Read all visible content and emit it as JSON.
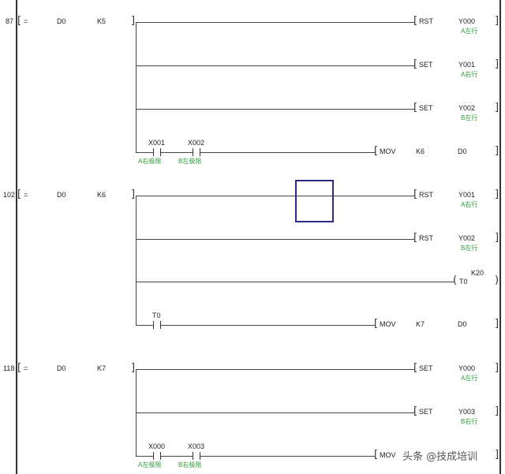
{
  "rungs": [
    {
      "step": "87",
      "compare": {
        "op": "=",
        "s1": "D0",
        "s2": "K5"
      },
      "outputs": [
        {
          "type": "instr",
          "instr": "RST",
          "operand": "Y000",
          "comment": "A左行"
        },
        {
          "type": "instr",
          "instr": "SET",
          "operand": "Y001",
          "comment": "A右行"
        },
        {
          "type": "instr",
          "instr": "SET",
          "operand": "Y002",
          "comment": "B左行"
        },
        {
          "type": "mov",
          "contacts": [
            {
              "name": "X001",
              "comment": "A右极限"
            },
            {
              "name": "X002",
              "comment": "B左极限"
            }
          ],
          "instr": "MOV",
          "src": "K6",
          "dst": "D0"
        }
      ]
    },
    {
      "step": "102",
      "compare": {
        "op": "=",
        "s1": "D0",
        "s2": "K6"
      },
      "outputs": [
        {
          "type": "instr",
          "instr": "RST",
          "operand": "Y001",
          "comment": "A右行"
        },
        {
          "type": "instr",
          "instr": "RST",
          "operand": "Y002",
          "comment": "B左行"
        },
        {
          "type": "timer",
          "coil": "T0",
          "preset": "K20"
        },
        {
          "type": "mov",
          "contacts": [
            {
              "name": "T0",
              "comment": ""
            }
          ],
          "instr": "MOV",
          "src": "K7",
          "dst": "D0"
        }
      ]
    },
    {
      "step": "118",
      "compare": {
        "op": "=",
        "s1": "D0",
        "s2": "K7"
      },
      "outputs": [
        {
          "type": "instr",
          "instr": "SET",
          "operand": "Y000",
          "comment": "A左行"
        },
        {
          "type": "instr",
          "instr": "SET",
          "operand": "Y003",
          "comment": "B右行"
        },
        {
          "type": "mov",
          "contacts": [
            {
              "name": "X000",
              "comment": "A左极限"
            },
            {
              "name": "X003",
              "comment": "B右极限"
            }
          ],
          "instr": "MOV",
          "src": "",
          "dst": ""
        }
      ]
    }
  ],
  "watermark": "头条 @技成培训",
  "colors": {
    "comment": "#2e9c3a",
    "selection": "#2a2a86",
    "line": "#444444"
  }
}
